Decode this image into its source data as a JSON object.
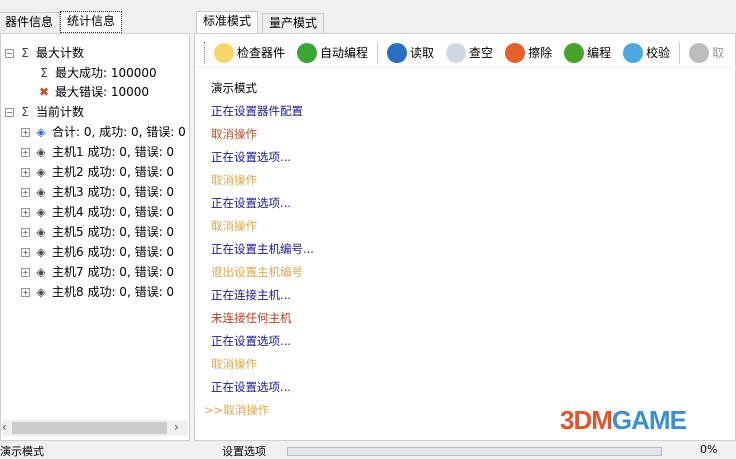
{
  "left_tabs": [
    "器件信息",
    "统计信息"
  ],
  "tree": {
    "max_count": {
      "label": "最大计数",
      "max_success": "最大成功: 100000",
      "max_error": "最大错误: 10000"
    },
    "current_count": {
      "label": "当前计数",
      "items": [
        "合计: 0, 成功: 0, 错误: 0",
        "主机1 成功: 0, 错误: 0",
        "主机2 成功: 0, 错误: 0",
        "主机3 成功: 0, 错误: 0",
        "主机4 成功: 0, 错误: 0",
        "主机5 成功: 0, 错误: 0",
        "主机6 成功: 0, 错误: 0",
        "主机7 成功: 0, 错误: 0",
        "主机8 成功: 0, 错误: 0"
      ]
    }
  },
  "right_tabs": [
    "标准模式",
    "量产模式"
  ],
  "toolbar": [
    {
      "label": "检查器件",
      "icon": "lightbulb-icon",
      "color": "#f5d86a"
    },
    {
      "label": "自动编程",
      "icon": "play-icon",
      "color": "#3aa637"
    },
    {
      "label": "读取",
      "icon": "arrow-up-icon",
      "color": "#2a6fc0"
    },
    {
      "label": "查空",
      "icon": "magnifier-icon",
      "color": "#cfd8e0"
    },
    {
      "label": "擦除",
      "icon": "refresh-icon",
      "color": "#e5602a"
    },
    {
      "label": "编程",
      "icon": "arrow-down-icon",
      "color": "#48a22b"
    },
    {
      "label": "校验",
      "icon": "verify-icon",
      "color": "#4ca8e0"
    },
    {
      "label": "取",
      "icon": "cancel-icon",
      "color": "#bdbdbd"
    }
  ],
  "log": [
    {
      "text": "演示模式",
      "color": "#000000"
    },
    {
      "text": "正在设置器件配置",
      "color": "#1a1aa0"
    },
    {
      "text": "取消操作",
      "color": "#c0502a"
    },
    {
      "text": "正在设置选项...",
      "color": "#1a1aa0"
    },
    {
      "text": "取消操作",
      "color": "#e0a850"
    },
    {
      "text": "正在设置选项...",
      "color": "#1a1aa0"
    },
    {
      "text": "取消操作",
      "color": "#e0a850"
    },
    {
      "text": "正在设置主机编号...",
      "color": "#1a1aa0"
    },
    {
      "text": "退出设置主机编号",
      "color": "#e0a850"
    },
    {
      "text": "正在连接主机...",
      "color": "#1a1aa0"
    },
    {
      "text": "未连接任何主机",
      "color": "#c03a1a"
    },
    {
      "text": "正在设置选项...",
      "color": "#1a1aa0"
    },
    {
      "text": "取消操作",
      "color": "#e0a850"
    },
    {
      "text": "正在设置选项...",
      "color": "#1a1aa0"
    },
    {
      "text": ">>取消操作",
      "color": "#e0a850"
    }
  ],
  "status": {
    "mode": "演示模式",
    "action": "设置选项",
    "progress": "0%",
    "progress_value": 0
  },
  "watermark": "3DMGAME"
}
